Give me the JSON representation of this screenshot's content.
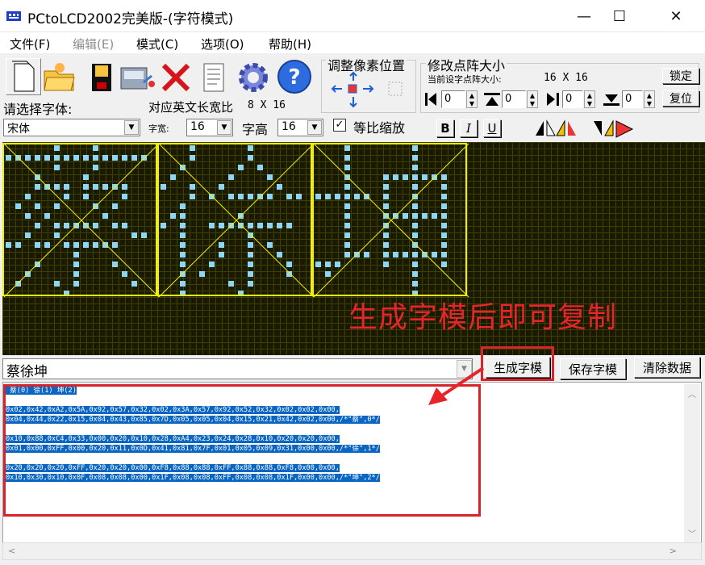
{
  "window": {
    "title": "PCtoLCD2002完美版-(字符模式)",
    "minimize": "—",
    "maximize": "☐",
    "close": "✕"
  },
  "menu": [
    {
      "label": "文件(F)",
      "enabled": true
    },
    {
      "label": "编辑(E)",
      "enabled": false
    },
    {
      "label": "模式(C)",
      "enabled": true
    },
    {
      "label": "选项(O)",
      "enabled": true
    },
    {
      "label": "帮助(H)",
      "enabled": true
    }
  ],
  "pixel_adjust": {
    "title": "调整像素位置"
  },
  "matrix_size": {
    "title": "修改点阵大小",
    "current_label": "当前设字点阵大小:",
    "current_value": "16 X 16",
    "lock": "锁定",
    "reset": "复位",
    "spins": [
      "0",
      "0",
      "0",
      "0"
    ]
  },
  "font": {
    "label": "请选择字体:",
    "ratio_label": "对应英文长宽比",
    "ratio_value": "8 X 16",
    "name": "宋体",
    "width_label": "字宽:",
    "width_value": "16",
    "height_label": "字高",
    "height_value": "16",
    "proportional_label": "等比缩放",
    "proportional_checked": true
  },
  "style_buttons": {
    "bold": "B",
    "italic": "I",
    "underline": "U"
  },
  "annotation": "生成字模后即可复制",
  "input_text": "蔡徐坤",
  "buttons": {
    "generate": "生成字模",
    "save": "保存字模",
    "clear": "清除数据"
  },
  "output_lines": [
    " 蔡(0) 徐(1) 坤(2)",
    "",
    "0x02,0x42,0xA2,0x5A,0x92,0x57,0x32,0x02,0x3A,0x57,0x92,0x52,0x32,0x02,0x02,0x00,",
    "0x04,0x44,0x22,0x15,0x04,0x43,0x85,0x7D,0x05,0x05,0x04,0x15,0x21,0x42,0x02,0x00,/*\"蔡\",0*/",
    "",
    "0x10,0x88,0xC4,0x33,0x00,0x20,0x10,0x28,0xA4,0x23,0x24,0x28,0x10,0x20,0x20,0x00,",
    "0x01,0x00,0xFF,0x00,0x20,0x11,0x0D,0x41,0x81,0x7F,0x01,0x05,0x09,0x31,0x00,0x00,/*\"徐\",1*/",
    "",
    "0x20,0x20,0x20,0xFF,0x20,0x20,0x00,0xF8,0x88,0x88,0xFF,0x88,0x88,0xF8,0x00,0x00,",
    "0x10,0x30,0x10,0x0F,0x08,0x08,0x00,0x1F,0x08,0x08,0xFF,0x08,0x08,0x1F,0x00,0x00,/*\"坤\",2*/"
  ],
  "icons": [
    "new-file-icon",
    "open-folder-icon",
    "save-disk-icon",
    "scanner-icon",
    "delete-x-icon",
    "notepad-icon",
    "gear-icon",
    "help-icon"
  ],
  "colors": {
    "matrix_bg": "#1a1a00",
    "grid": "#3e4000",
    "pixel_on": "#8fd6f4",
    "box": "#f0f000",
    "annotation": "#e8232a",
    "selection": "#0a66c2"
  }
}
